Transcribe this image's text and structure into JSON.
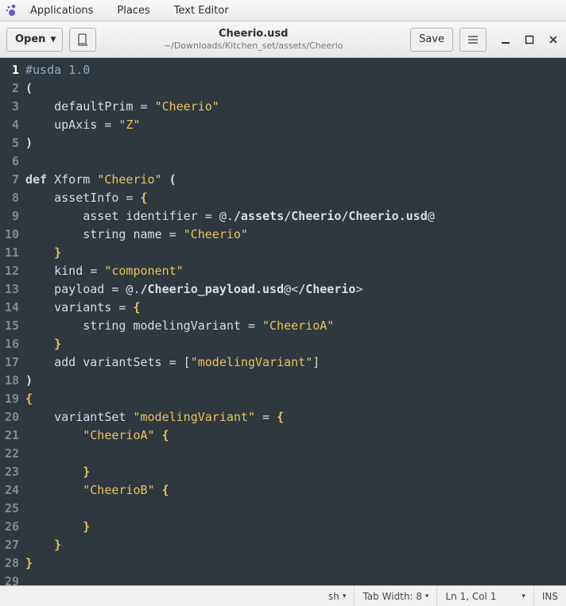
{
  "menubar": {
    "applications": "Applications",
    "places": "Places",
    "texteditor": "Text Editor"
  },
  "toolbar": {
    "open_label": "Open",
    "save_label": "Save",
    "title": "Cheerio.usd",
    "subtitle": "~/Downloads/Kitchen_set/assets/Cheerio"
  },
  "code": {
    "lines": [
      {
        "n": 1,
        "seg": [
          {
            "t": "#usda 1.0",
            "c": "c-cmt"
          }
        ]
      },
      {
        "n": 2,
        "seg": [
          {
            "t": "(",
            "c": "c-punc"
          }
        ]
      },
      {
        "n": 3,
        "seg": [
          {
            "t": "    defaultPrim = ",
            "c": "c-op"
          },
          {
            "t": "\"Cheerio\"",
            "c": "c-str"
          }
        ]
      },
      {
        "n": 4,
        "seg": [
          {
            "t": "    upAxis = ",
            "c": "c-op"
          },
          {
            "t": "\"Z\"",
            "c": "c-str"
          }
        ]
      },
      {
        "n": 5,
        "seg": [
          {
            "t": ")",
            "c": "c-punc"
          }
        ]
      },
      {
        "n": 6,
        "seg": [
          {
            "t": "",
            "c": ""
          }
        ]
      },
      {
        "n": 7,
        "seg": [
          {
            "t": "def",
            "c": "c-key"
          },
          {
            "t": " Xform ",
            "c": "c-op"
          },
          {
            "t": "\"Cheerio\"",
            "c": "c-str"
          },
          {
            "t": " (",
            "c": "c-punc"
          }
        ]
      },
      {
        "n": 8,
        "seg": [
          {
            "t": "    assetInfo = ",
            "c": "c-op"
          },
          {
            "t": "{",
            "c": "c-punc-y"
          }
        ]
      },
      {
        "n": 9,
        "seg": [
          {
            "t": "        asset identifier = @.",
            "c": "c-op"
          },
          {
            "t": "/assets/Cheerio/Cheerio.usd",
            "c": "c-var"
          },
          {
            "t": "@",
            "c": "c-op"
          }
        ]
      },
      {
        "n": 10,
        "seg": [
          {
            "t": "        string name = ",
            "c": "c-op"
          },
          {
            "t": "\"Cheerio\"",
            "c": "c-str"
          }
        ]
      },
      {
        "n": 11,
        "seg": [
          {
            "t": "    ",
            "c": ""
          },
          {
            "t": "}",
            "c": "c-punc-y"
          }
        ]
      },
      {
        "n": 12,
        "seg": [
          {
            "t": "    kind = ",
            "c": "c-op"
          },
          {
            "t": "\"component\"",
            "c": "c-str"
          }
        ]
      },
      {
        "n": 13,
        "seg": [
          {
            "t": "    payload = @.",
            "c": "c-op"
          },
          {
            "t": "/Cheerio_payload.usd",
            "c": "c-var"
          },
          {
            "t": "@<",
            "c": "c-op"
          },
          {
            "t": "/Cheerio",
            "c": "c-var"
          },
          {
            "t": ">",
            "c": "c-op"
          }
        ]
      },
      {
        "n": 14,
        "seg": [
          {
            "t": "    variants = ",
            "c": "c-op"
          },
          {
            "t": "{",
            "c": "c-punc-y"
          }
        ]
      },
      {
        "n": 15,
        "seg": [
          {
            "t": "        string modelingVariant = ",
            "c": "c-op"
          },
          {
            "t": "\"CheerioA\"",
            "c": "c-str"
          }
        ]
      },
      {
        "n": 16,
        "seg": [
          {
            "t": "    ",
            "c": ""
          },
          {
            "t": "}",
            "c": "c-punc-y"
          }
        ]
      },
      {
        "n": 17,
        "seg": [
          {
            "t": "    add variantSets = [",
            "c": "c-op"
          },
          {
            "t": "\"modelingVariant\"",
            "c": "c-str"
          },
          {
            "t": "]",
            "c": "c-op"
          }
        ]
      },
      {
        "n": 18,
        "seg": [
          {
            "t": ")",
            "c": "c-punc"
          }
        ]
      },
      {
        "n": 19,
        "seg": [
          {
            "t": "{",
            "c": "c-punc-y"
          }
        ]
      },
      {
        "n": 20,
        "seg": [
          {
            "t": "    variantSet ",
            "c": "c-op"
          },
          {
            "t": "\"modelingVariant\"",
            "c": "c-str"
          },
          {
            "t": " = ",
            "c": "c-op"
          },
          {
            "t": "{",
            "c": "c-punc-y"
          }
        ]
      },
      {
        "n": 21,
        "seg": [
          {
            "t": "        ",
            "c": ""
          },
          {
            "t": "\"CheerioA\"",
            "c": "c-str"
          },
          {
            "t": " ",
            "c": ""
          },
          {
            "t": "{",
            "c": "c-punc-y"
          }
        ]
      },
      {
        "n": 22,
        "seg": [
          {
            "t": "",
            "c": ""
          }
        ]
      },
      {
        "n": 23,
        "seg": [
          {
            "t": "        ",
            "c": ""
          },
          {
            "t": "}",
            "c": "c-punc-y"
          }
        ]
      },
      {
        "n": 24,
        "seg": [
          {
            "t": "        ",
            "c": ""
          },
          {
            "t": "\"CheerioB\"",
            "c": "c-str"
          },
          {
            "t": " ",
            "c": ""
          },
          {
            "t": "{",
            "c": "c-punc-y"
          }
        ]
      },
      {
        "n": 25,
        "seg": [
          {
            "t": "",
            "c": ""
          }
        ]
      },
      {
        "n": 26,
        "seg": [
          {
            "t": "        ",
            "c": ""
          },
          {
            "t": "}",
            "c": "c-punc-y"
          }
        ]
      },
      {
        "n": 27,
        "seg": [
          {
            "t": "    ",
            "c": ""
          },
          {
            "t": "}",
            "c": "c-punc-y"
          }
        ]
      },
      {
        "n": 28,
        "seg": [
          {
            "t": "}",
            "c": "c-punc-y"
          }
        ]
      },
      {
        "n": 29,
        "seg": [
          {
            "t": "",
            "c": ""
          }
        ]
      }
    ],
    "current_line": 1
  },
  "status": {
    "lang": "sh",
    "tabwidth": "Tab Width: 8",
    "position": "Ln 1, Col 1",
    "insert": "INS"
  }
}
